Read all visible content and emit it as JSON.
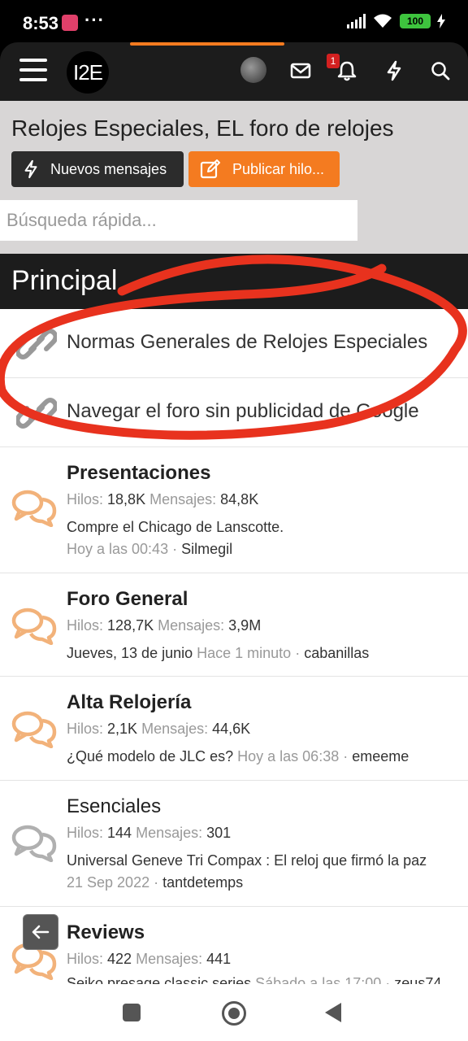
{
  "status_bar": {
    "time": "8:53",
    "dots": "···",
    "battery": "100"
  },
  "header": {
    "logo_text": "I2E",
    "notification_count": "1"
  },
  "hero": {
    "title": "Relojes Especiales, EL foro de relojes",
    "new_posts_label": "Nuevos mensajes",
    "post_thread_label": "Publicar hilo...",
    "search_placeholder": "Búsqueda rápida..."
  },
  "section": {
    "title": "Principal"
  },
  "links": [
    {
      "label": "Normas Generales de Relojes Especiales"
    },
    {
      "label": "Navegar el foro sin publicidad de Google"
    }
  ],
  "forums": [
    {
      "name": "Presentaciones",
      "threads_label": "Hilos:",
      "threads": "18,8K",
      "posts_label": "Mensajes:",
      "posts": "84,8K",
      "last_title": "Compre el Chicago de Lanscotte.",
      "last_time": "Hoy a las 00:43",
      "last_user": "Silmegil",
      "icon": "chat-bubbles-orange-icon"
    },
    {
      "name": "Foro General",
      "threads_label": "Hilos:",
      "threads": "128,7K",
      "posts_label": "Mensajes:",
      "posts": "3,9M",
      "last_title": "Jueves, 13 de junio",
      "last_time": "Hace 1 minuto",
      "last_user": "cabanillas",
      "icon": "chat-bubbles-orange-icon"
    },
    {
      "name": "Alta Relojería",
      "threads_label": "Hilos:",
      "threads": "2,1K",
      "posts_label": "Mensajes:",
      "posts": "44,6K",
      "last_title": "¿Qué modelo de JLC es?",
      "last_time": "Hoy a las 06:38",
      "last_user": "emeeme",
      "icon": "chat-bubbles-orange-icon"
    },
    {
      "name": "Esenciales",
      "threads_label": "Hilos:",
      "threads": "144",
      "posts_label": "Mensajes:",
      "posts": "301",
      "last_title": "Universal Geneve Tri Compax : El reloj que firmó la paz",
      "last_time": "21 Sep 2022",
      "last_user": "tantdetemps",
      "icon": "chat-bubbles-gray-icon"
    },
    {
      "name": "Reviews",
      "threads_label": "Hilos:",
      "threads": "422",
      "posts_label": "Mensajes:",
      "posts": "441",
      "last_title": "Seiko presage classic series",
      "last_time": "Sábado a las 17:00",
      "last_user": "zeus74",
      "icon": "chat-bubbles-orange-icon"
    }
  ],
  "colors": {
    "accent": "#f47b20",
    "header_bg": "#1c1c1c",
    "hero_bg": "#d8d6d6",
    "annotation": "#e8321e"
  }
}
